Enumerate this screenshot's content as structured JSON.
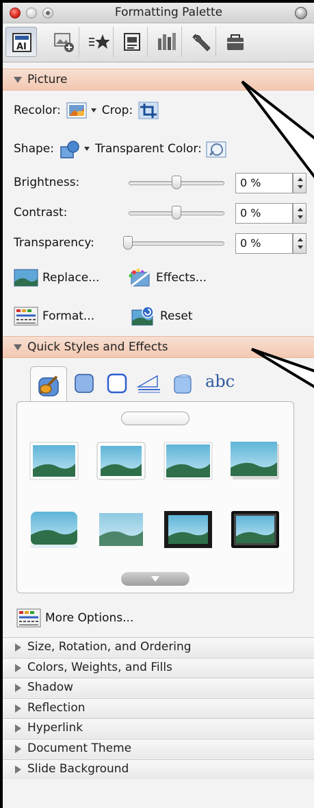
{
  "window": {
    "title": "Formatting Palette"
  },
  "toolbar": {
    "tabs": [
      {
        "icon": "text-box-icon",
        "selected": true
      },
      {
        "icon": "add-picture-icon",
        "selected": false
      },
      {
        "icon": "bullet-star-icon",
        "selected": false
      },
      {
        "icon": "document-elements-icon",
        "selected": false
      },
      {
        "icon": "bar-chart-icon",
        "selected": false
      },
      {
        "icon": "wrench-icon",
        "selected": false
      },
      {
        "icon": "toolbox-icon",
        "selected": false
      }
    ]
  },
  "picture": {
    "header": "Picture",
    "recolor_label": "Recolor:",
    "crop_label": "Crop:",
    "shape_label": "Shape:",
    "transparent_color_label": "Transparent Color:",
    "brightness": {
      "label": "Brightness:",
      "value": "0 %",
      "level": 0.5
    },
    "contrast": {
      "label": "Contrast:",
      "value": "0 %",
      "level": 0.5
    },
    "transparency": {
      "label": "Transparency:",
      "value": "0 %",
      "level": 0.0
    },
    "replace_label": "Replace...",
    "effects_label": "Effects...",
    "format_label": "Format...",
    "reset_label": "Reset"
  },
  "quick_styles": {
    "header": "Quick Styles and Effects",
    "tab_text_label": "abc",
    "more_options_label": "More Options..."
  },
  "collapsed_sections": [
    "Size, Rotation, and Ordering",
    "Colors, Weights, and Fills",
    "Shadow",
    "Reflection",
    "Hyperlink",
    "Document Theme",
    "Slide Background"
  ],
  "colors": {
    "section_header": "#f3c8b1",
    "selection_blue": "#3a6fd1"
  }
}
